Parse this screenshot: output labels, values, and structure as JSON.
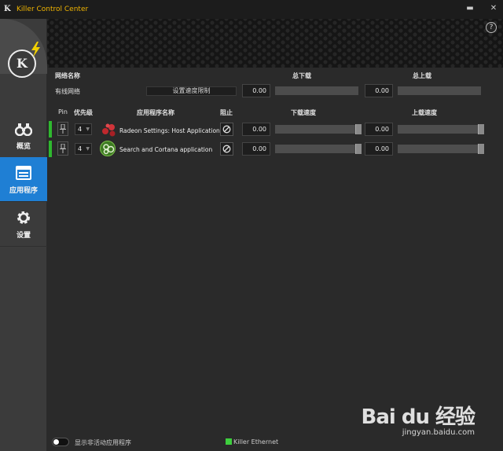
{
  "window": {
    "title": "Killer Control Center",
    "app_icon": "K",
    "min_glyph": "▬",
    "close_glyph": "✕",
    "help_glyph": "?"
  },
  "sidebar": {
    "logo_glyph": "K",
    "items": [
      {
        "label": "概览",
        "icon": "binoculars-icon",
        "active": false
      },
      {
        "label": "应用程序",
        "icon": "window-icon",
        "active": true
      },
      {
        "label": "设置",
        "icon": "gear-icon",
        "active": false
      }
    ]
  },
  "network": {
    "col_name": "网络名称",
    "col_total_down": "总下载",
    "col_total_up": "总上载",
    "name": "有线网络",
    "limit_button": "设置速度限制",
    "down_value": "0.00",
    "up_value": "0.00"
  },
  "apps_table": {
    "headers": {
      "pin": "Pin",
      "priority": "优先级",
      "app_name": "应用程序名称",
      "block": "阻止",
      "down_speed": "下载速度",
      "up_speed": "上载速度"
    },
    "rows": [
      {
        "priority": "4",
        "name": "Radeon Settings: Host Application",
        "down": "0.00",
        "up": "0.00",
        "icon": "radeon-icon",
        "icon_color": "#c0282d"
      },
      {
        "priority": "4",
        "name": "Search and Cortana application",
        "down": "0.00",
        "up": "0.00",
        "icon": "cortana-icon",
        "icon_color": "#5aa02c"
      }
    ]
  },
  "footer": {
    "toggle_label": "显示非活动应用程序",
    "adapter": "Killer Ethernet"
  },
  "watermark": {
    "brand": "Bai du 经验",
    "url": "jingyan.baidu.com"
  },
  "colors": {
    "accent_blue": "#1f7fd4",
    "title_orange": "#f0b400",
    "active_green": "#2fb82f"
  }
}
